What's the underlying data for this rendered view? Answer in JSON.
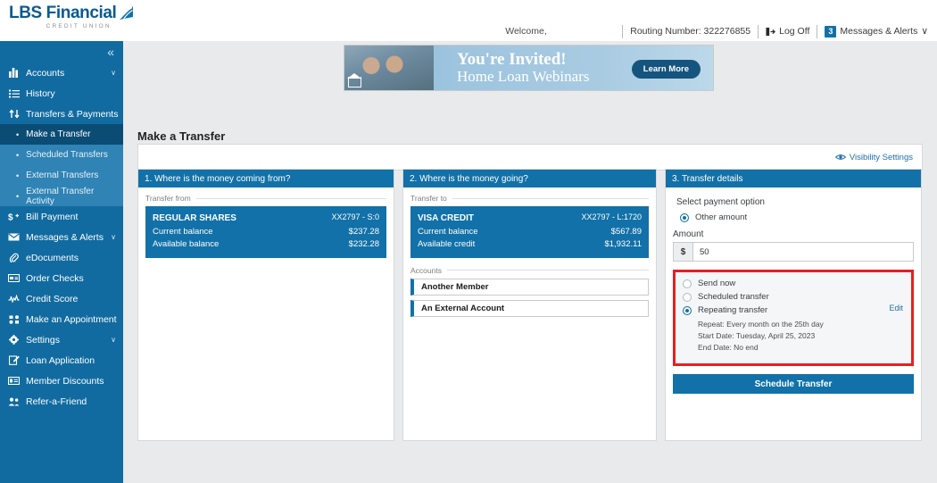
{
  "brand": {
    "name": "LBS Financial",
    "tagline": "CREDIT UNION"
  },
  "topnav": {
    "welcome": "Welcome,",
    "routing": "Routing Number: 322276855",
    "logoff": "Log Off",
    "messages": "Messages & Alerts",
    "messages_badge": "3",
    "chevron": "∨"
  },
  "sidebar": {
    "collapse": "«",
    "items": [
      {
        "label": "Accounts",
        "icon": "bar-chart-icon",
        "chevron": "∨"
      },
      {
        "label": "History",
        "icon": "list-icon",
        "chevron": ""
      },
      {
        "label": "Transfers & Payments",
        "icon": "transfers-icon",
        "chevron": "∧"
      }
    ],
    "subitems": [
      {
        "label": "Make a Transfer",
        "active": true
      },
      {
        "label": "Scheduled Transfers",
        "active": false
      },
      {
        "label": "External Transfers",
        "active": false
      },
      {
        "label": "External Transfer Activity",
        "active": false
      }
    ],
    "items2": [
      {
        "label": "Bill Payment",
        "icon": "dollar-icon",
        "chevron": ""
      },
      {
        "label": "Messages & Alerts",
        "icon": "envelope-icon",
        "chevron": "∨"
      },
      {
        "label": "eDocuments",
        "icon": "paperclip-icon",
        "chevron": ""
      },
      {
        "label": "Order Checks",
        "icon": "check-icon",
        "chevron": ""
      },
      {
        "label": "Credit Score",
        "icon": "credit-score-icon",
        "chevron": ""
      },
      {
        "label": "Make an Appointment",
        "icon": "appointment-icon",
        "chevron": ""
      },
      {
        "label": "Settings",
        "icon": "gear-icon",
        "chevron": "∨"
      },
      {
        "label": "Loan Application",
        "icon": "pencil-icon",
        "chevron": ""
      },
      {
        "label": "Member Discounts",
        "icon": "discount-icon",
        "chevron": ""
      },
      {
        "label": "Refer-a-Friend",
        "icon": "people-icon",
        "chevron": ""
      }
    ]
  },
  "promo": {
    "title": "You're Invited!",
    "subtitle": "Home Loan Webinars",
    "button": "Learn More"
  },
  "page": {
    "title": "Make a Transfer",
    "visibility_settings": "Visibility Settings"
  },
  "panel1": {
    "header": "1. Where is the money coming from?",
    "fieldset": "Transfer from",
    "account": {
      "name": "REGULAR SHARES",
      "number": "XX2797 - S:0",
      "rows": [
        {
          "label": "Current balance",
          "value": "$237.28"
        },
        {
          "label": "Available balance",
          "value": "$232.28"
        }
      ]
    }
  },
  "panel2": {
    "header": "2. Where is the money going?",
    "fieldset": "Transfer to",
    "account": {
      "name": "VISA CREDIT",
      "number": "XX2797 - L:1720",
      "rows": [
        {
          "label": "Current balance",
          "value": "$567.89"
        },
        {
          "label": "Available credit",
          "value": "$1,932.11"
        }
      ]
    },
    "accounts_label": "Accounts",
    "options": [
      {
        "label": "Another Member"
      },
      {
        "label": "An External Account"
      }
    ]
  },
  "panel3": {
    "header": "3. Transfer details",
    "payment_option_label": "Select payment option",
    "payment_options": [
      {
        "label": "Other amount",
        "selected": true
      }
    ],
    "amount_label": "Amount",
    "amount_prefix": "$",
    "amount_value": "50",
    "schedule_options": [
      {
        "label": "Send now",
        "selected": false
      },
      {
        "label": "Scheduled transfer",
        "selected": false
      },
      {
        "label": "Repeating transfer",
        "selected": true
      }
    ],
    "edit_link": "Edit",
    "repeat_details": [
      "Repeat: Every month on the 25th day",
      "Start Date: Tuesday, April 25, 2023",
      "End Date: No end"
    ],
    "submit": "Schedule Transfer"
  },
  "colors": {
    "brand_blue": "#116ba0",
    "panel_blue": "#1271a8",
    "active_nav": "#0b4c74",
    "sub_nav": "#2f83b5",
    "highlight_red": "#ec1c24",
    "link_blue": "#1f6fa8"
  }
}
